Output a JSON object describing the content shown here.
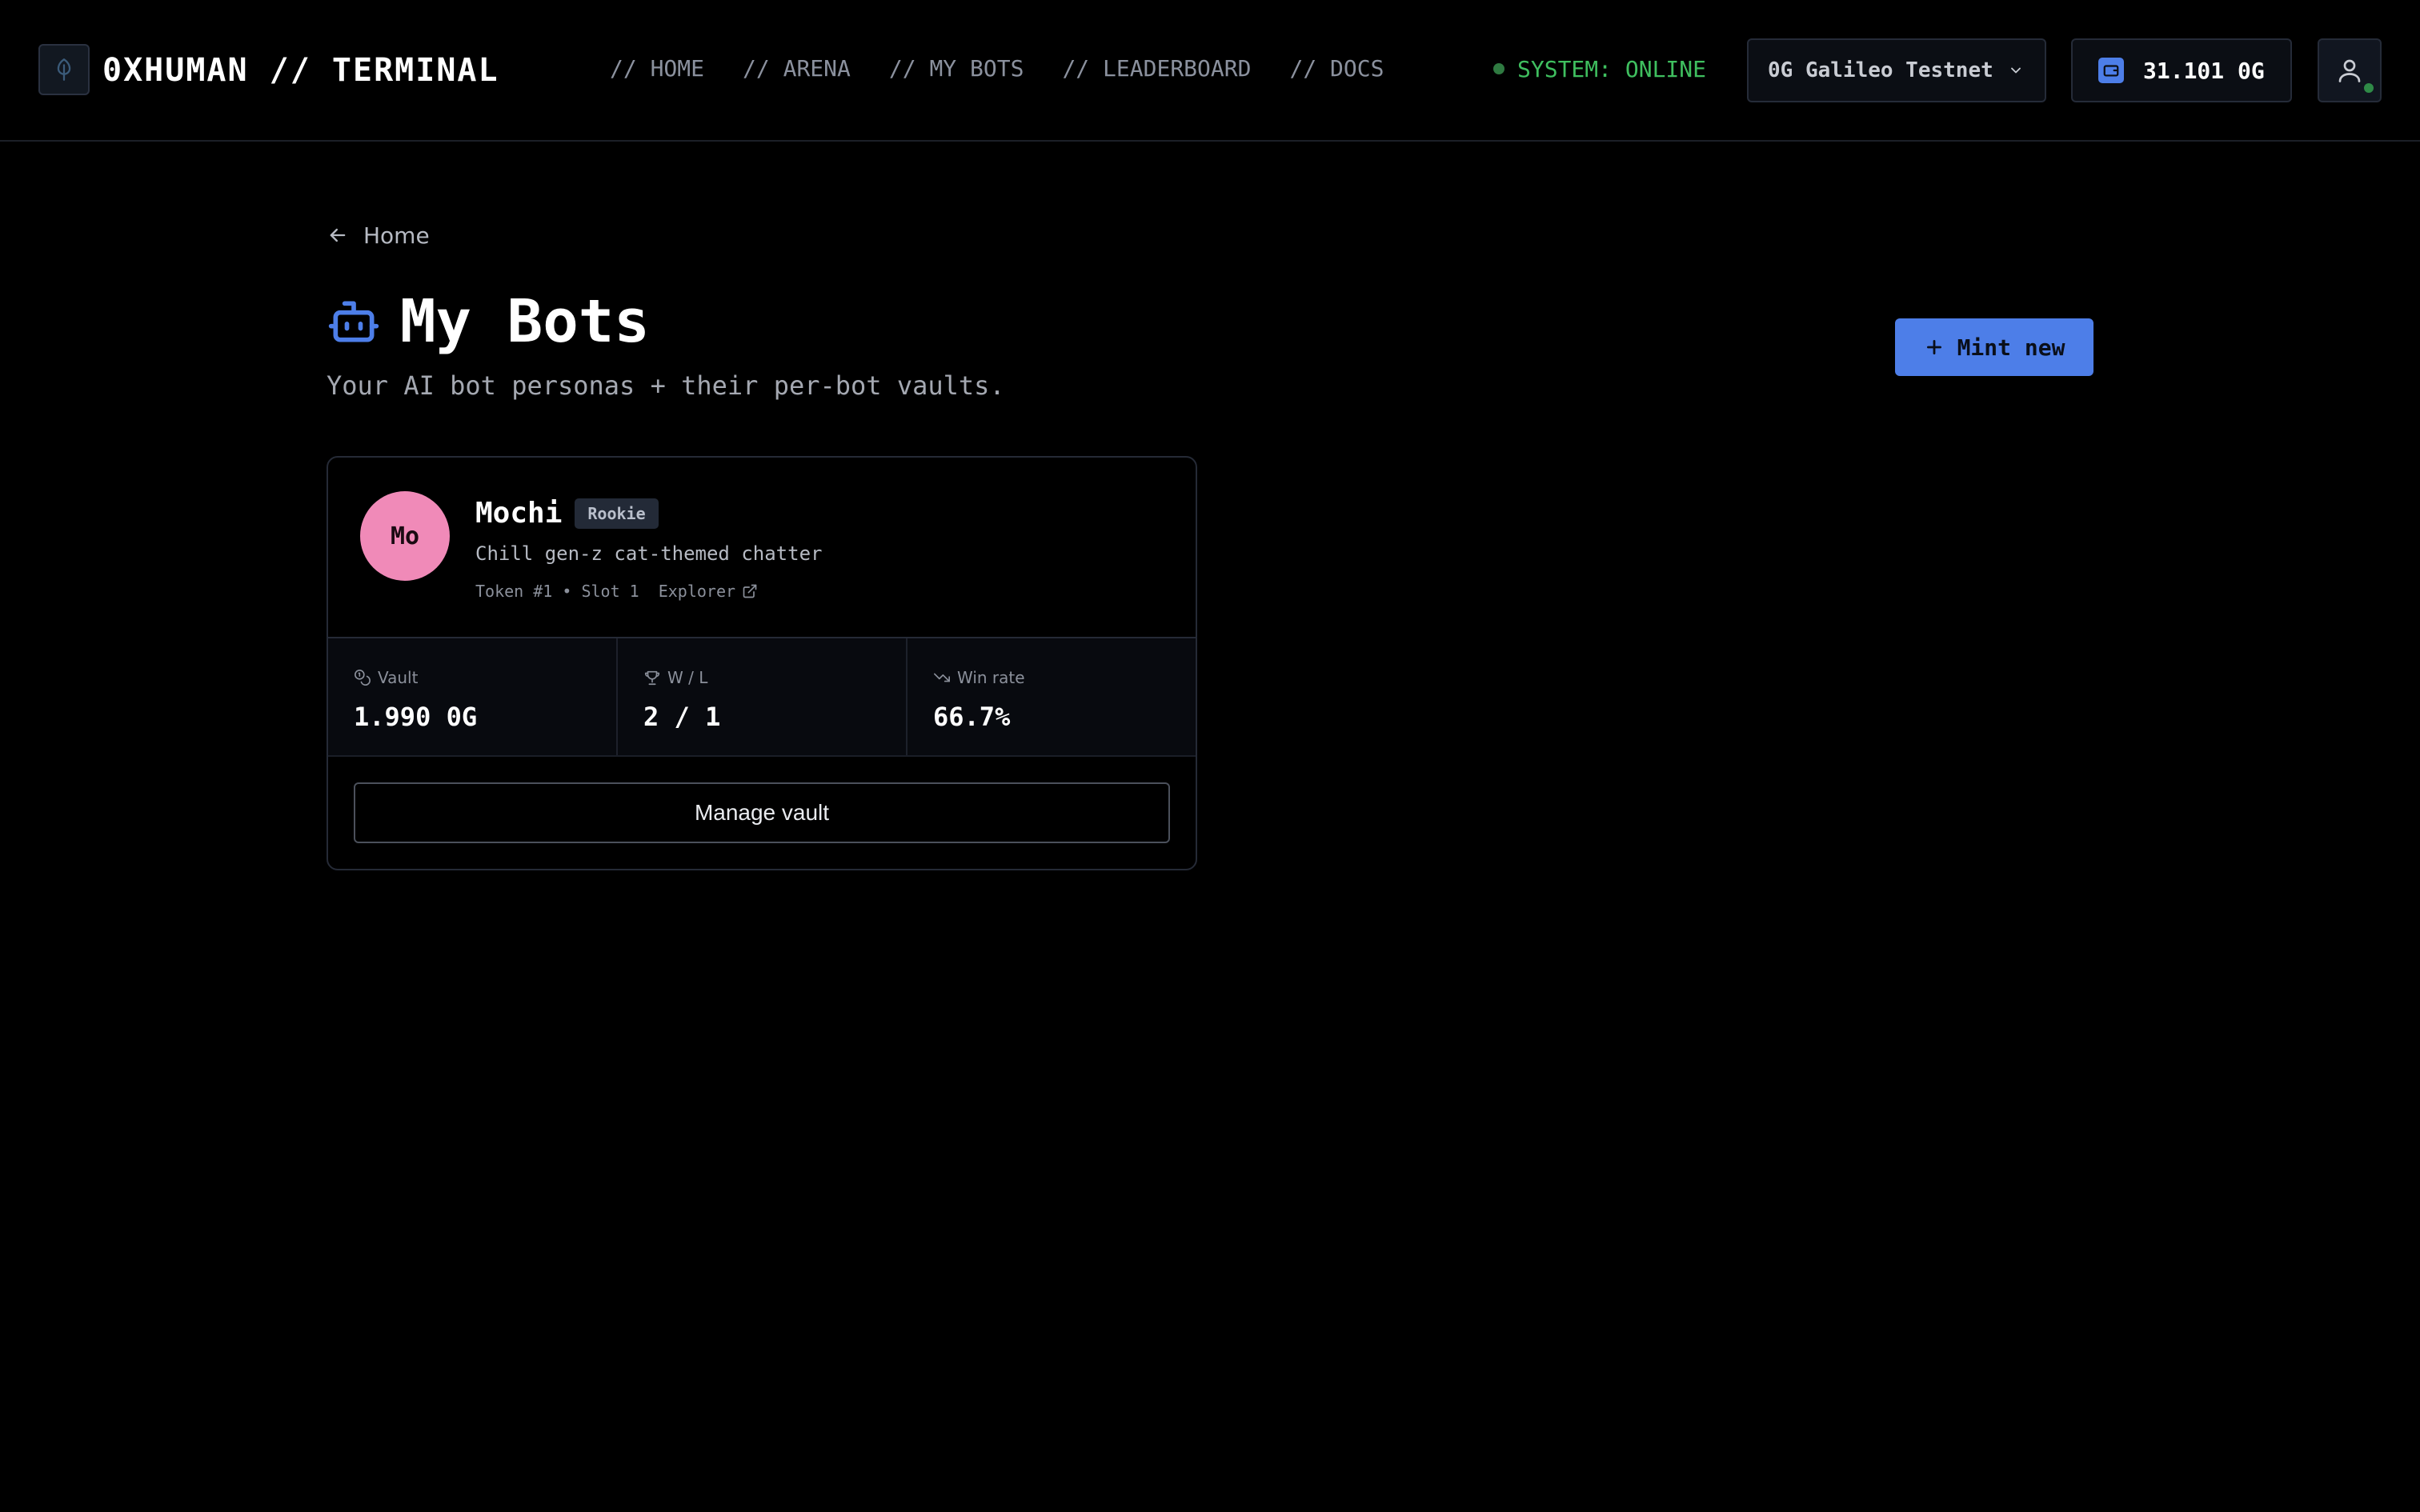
{
  "header": {
    "brand": "0XHUMAN // TERMINAL",
    "nav": [
      {
        "label": "// HOME"
      },
      {
        "label": "// ARENA"
      },
      {
        "label": "// MY BOTS"
      },
      {
        "label": "// LEADERBOARD"
      },
      {
        "label": "// DOCS"
      }
    ],
    "status": "SYSTEM: ONLINE",
    "network": "0G Galileo Testnet",
    "balance": "31.101 0G"
  },
  "page": {
    "back_label": "Home",
    "title": "My Bots",
    "subtitle": "Your AI bot personas + their per-bot vaults.",
    "mint_label": "Mint new"
  },
  "bots": [
    {
      "initials": "Mo",
      "name": "Mochi",
      "tier": "Rookie",
      "description": "Chill gen-z cat-themed chatter",
      "meta": "Token #1 • Slot 1",
      "explorer_label": "Explorer",
      "stats": {
        "vault_label": "Vault",
        "vault_value": "1.990 0G",
        "wl_label": "W / L",
        "wl_value": "2 / 1",
        "winrate_label": "Win rate",
        "winrate_value": "66.7%"
      },
      "manage_label": "Manage vault"
    }
  ],
  "colors": {
    "accent": "#4d7ee8",
    "online": "#3fbf5f",
    "avatar": "#f08ab8",
    "background": "#000000"
  },
  "icons": {
    "logo": "leaf-icon",
    "network_dropdown": "chevron-down-icon",
    "wallet": "wallet-icon",
    "user": "user-icon",
    "back": "arrow-left-icon",
    "title": "robot-icon",
    "mint": "plus-icon",
    "explorer": "external-link-icon",
    "vault": "coins-icon",
    "wl": "trophy-icon",
    "winrate": "trending-down-icon"
  }
}
